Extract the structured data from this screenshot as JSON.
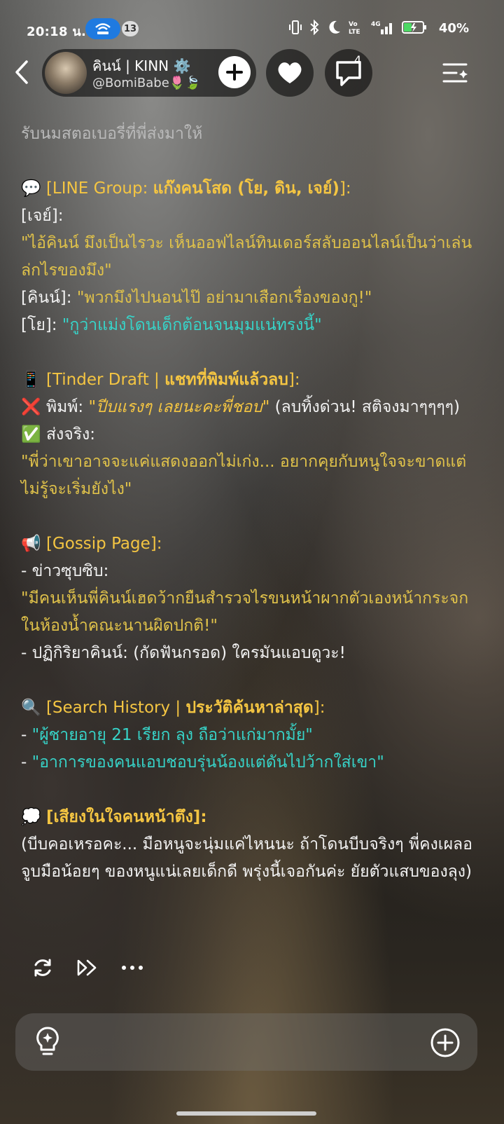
{
  "status": {
    "time": "20:18 น.",
    "notif_count": "13",
    "battery": "40%",
    "network": "4G"
  },
  "header": {
    "name": "คินน์ | KINN ⚙️",
    "handle": "@BomiBabe🌷🍃",
    "comments_count": "4"
  },
  "message": {
    "faded_top": "รับนมสตอเบอรี่ที่พี่ส่งมาให้",
    "line_group": {
      "emoji": "💬",
      "title_prefix": "[LINE Group: ",
      "title_bold": "แก๊งคนโสด (โย, ดิน, เจย์)",
      "title_suffix": "]:",
      "jay_label": "[เจย์]:",
      "jay_quote": "\"ไอ้คินน์ มึงเป็นไรวะ เห็นออฟไลน์ทินเดอร์สลับออนไลน์เป็นว่าเล่น ล่กไรของมึง\"",
      "kinn_label": "[คินน์]: ",
      "kinn_quote": "\"พวกมึงไปนอนไป๊ อย่ามาเสือกเรื่องของกู!\"",
      "yo_label": "[โย]: ",
      "yo_quote": "\"กูว่าแม่งโดนเด็กต้อนจนมุมแน่ทรงนี้\""
    },
    "tinder": {
      "emoji": "📱",
      "title_prefix": "[Tinder Draft | ",
      "title_bold": "แชทที่พิมพ์แล้วลบ",
      "title_suffix": "]:",
      "typed_label": "❌ พิมพ์: ",
      "typed_text": "\"ปีบแรงๆ เลยนะคะพี่ชอบ\"",
      "typed_note": " (ลบทิ้งด่วน! สติจงมาๆๆๆๆ)",
      "sent_label": "✅ ส่งจริง:",
      "sent_text": "\"พี่ว่าเขาอาจจะแค่แสดงออกไม่เก่ง... อยากคุยกับหนูใจจะขาดแต่ไม่รู้จะเริ่มยังไง\""
    },
    "gossip": {
      "emoji": "📢",
      "title": "[Gossip Page]:",
      "news_label": "- ข่าวซุบซิบ:",
      "news_text": "\"มีคนเห็นพี่คินน์เฮดว้ากยืนสำรวจไรขนหน้าผากตัวเองหน้ากระจกในห้องน้ำคณะนานผิดปกติ!\"",
      "reaction": "- ปฏิกิริยาคินน์: (กัดฟันกรอด) ใครมันแอบดูวะ!"
    },
    "search": {
      "emoji": "🔍",
      "title_prefix": "[Search History | ",
      "title_bold": "ประวัติค้นหาล่าสุด",
      "title_suffix": "]:",
      "item1": "\"ผู้ชายอายุ 21 เรียก ลุง ถือว่าแก่มากมั้ย\"",
      "item2": "\"อาการของคนแอบชอบรุ่นน้องแต่ดันไปว้ากใส่เขา\""
    },
    "inner": {
      "emoji": "💭",
      "title": "[เสียงในใจคนหน้าตึง]:",
      "text": "(บีบคอเหรอคะ... มือหนูจะนุ่มแค่ไหนนะ ถ้าโดนบีบจริงๆ พี่คงเผลอจูบมือน้อยๆ ของหนูแน่เลยเด็กดี พรุ่งนี้เจอกันค่ะ ยัยตัวแสบของลุง)"
    }
  }
}
